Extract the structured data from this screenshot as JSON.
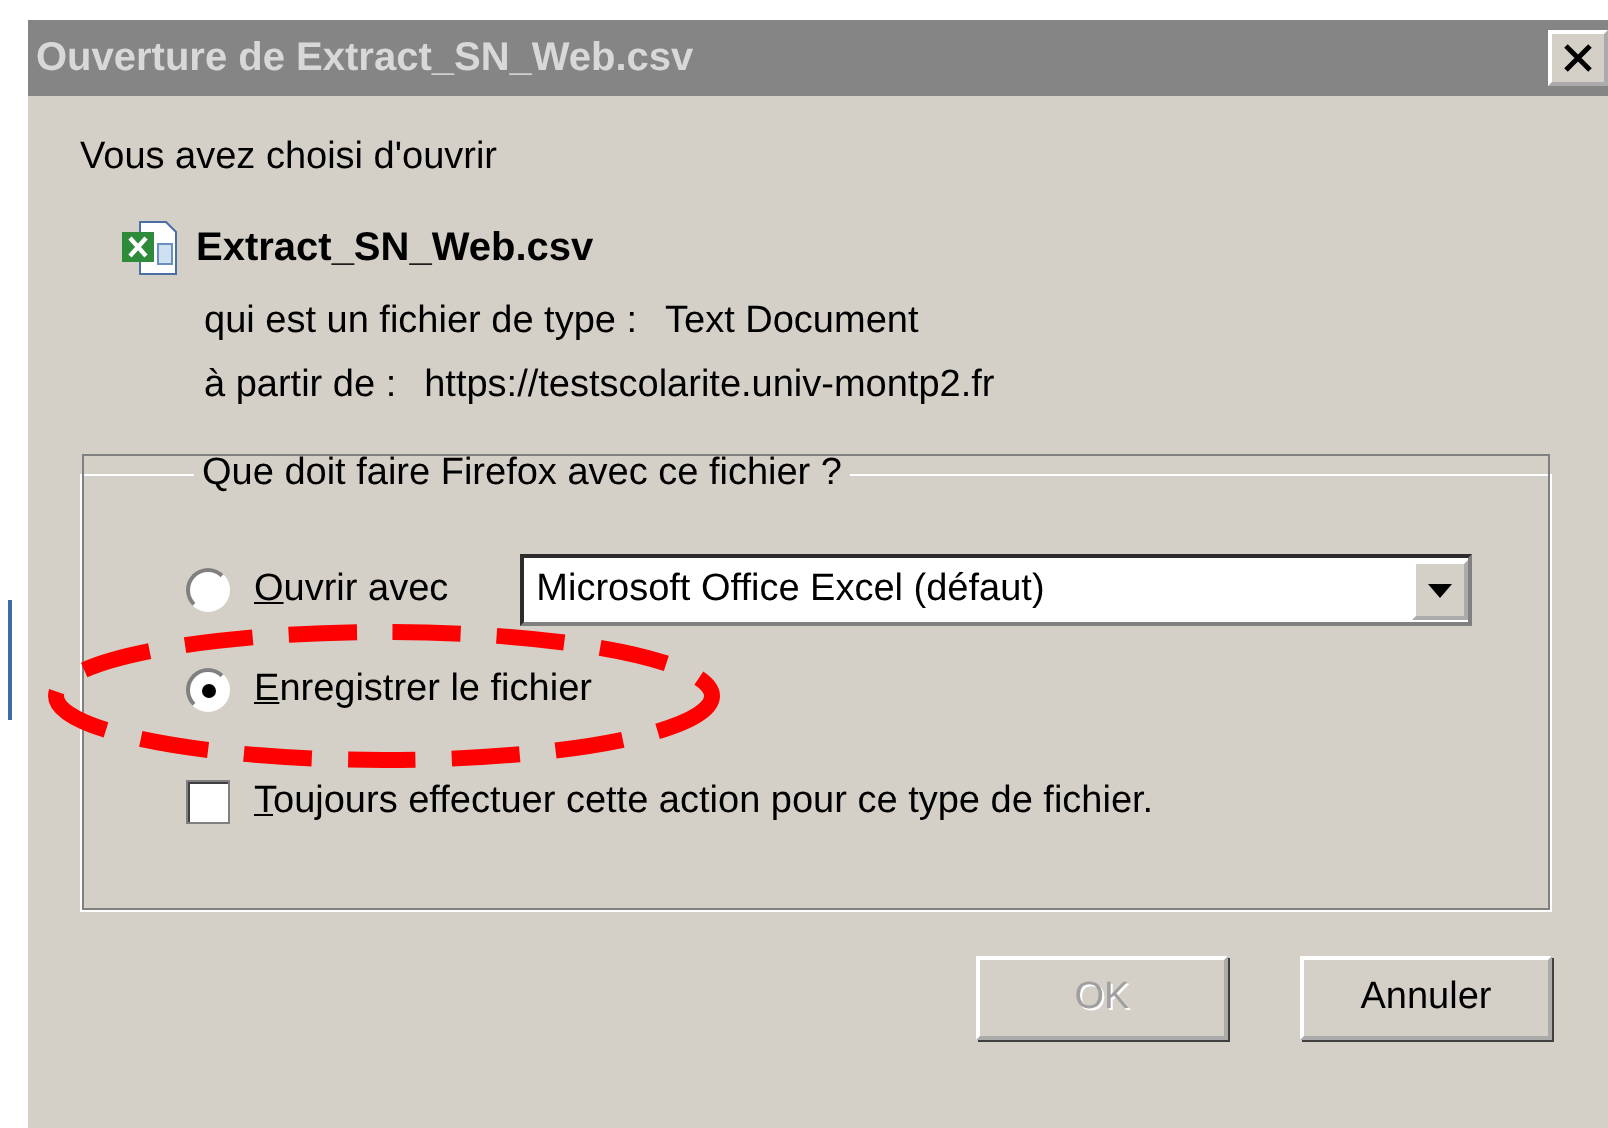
{
  "window": {
    "title": "Ouverture de Extract_SN_Web.csv"
  },
  "intro": "Vous avez choisi d'ouvrir",
  "file": {
    "name": "Extract_SN_Web.csv",
    "type_label": "qui est un fichier de type :",
    "type_value": "Text Document",
    "from_label": "à partir de :",
    "from_value": "https://testscolarite.univ-montp2.fr"
  },
  "group": {
    "legend": "Que doit faire Firefox avec ce fichier ?",
    "options": [
      {
        "label": "Ouvrir avec",
        "selected": false,
        "app": "Microsoft Office Excel (défaut)"
      },
      {
        "label": "Enregistrer le fichier",
        "selected": true
      }
    ],
    "always": {
      "label": "Toujours effectuer cette action pour ce type de fichier.",
      "checked": false
    }
  },
  "buttons": [
    {
      "label": "OK",
      "disabled": true
    },
    {
      "label": "Annuler",
      "disabled": false
    }
  ]
}
